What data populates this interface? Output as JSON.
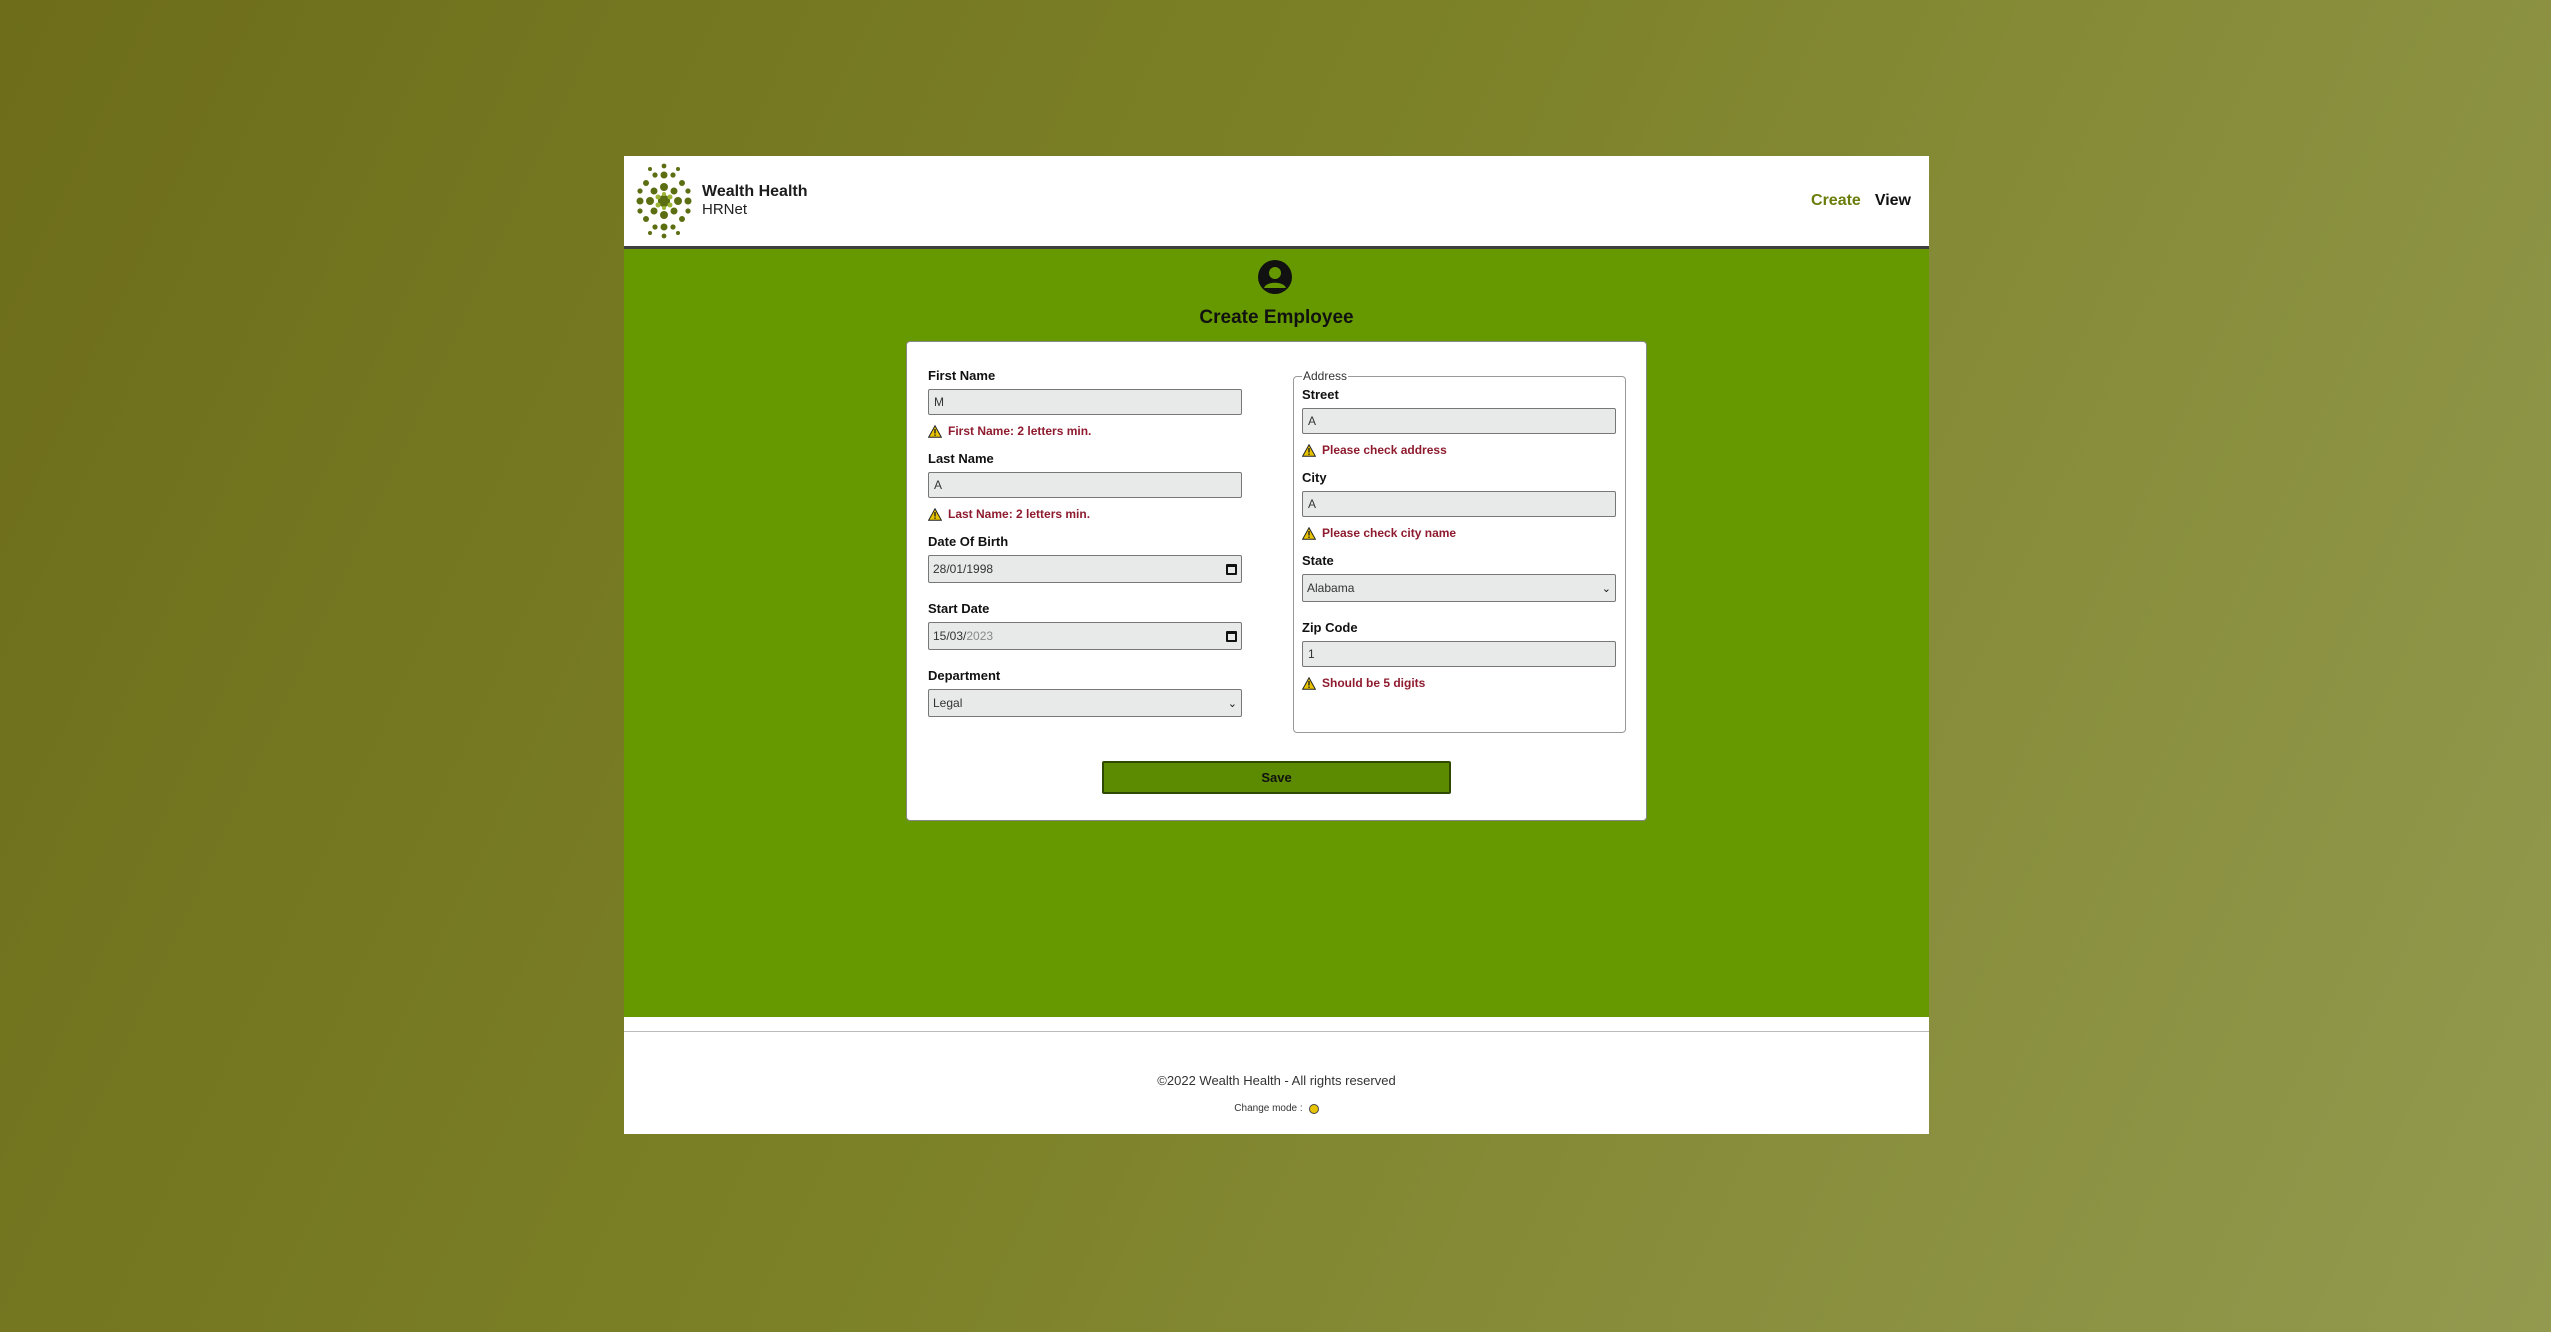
{
  "header": {
    "brand_name": "Wealth Health",
    "brand_sub": "HRNet",
    "nav": {
      "create": "Create",
      "view": "View"
    }
  },
  "page": {
    "title": "Create Employee"
  },
  "form": {
    "first_name": {
      "label": "First Name",
      "value": "M",
      "error": "First Name: 2 letters min."
    },
    "last_name": {
      "label": "Last Name",
      "value": "A",
      "error": "Last Name: 2 letters min."
    },
    "dob": {
      "label": "Date Of Birth",
      "value": "28/01/1998"
    },
    "start_date": {
      "label": "Start Date",
      "value_day_month": "15/03/",
      "value_year": "2023"
    },
    "department": {
      "label": "Department",
      "value": "Legal"
    },
    "address": {
      "legend": "Address",
      "street": {
        "label": "Street",
        "value": "A",
        "error": "Please check address"
      },
      "city": {
        "label": "City",
        "value": "A",
        "error": "Please check city name"
      },
      "state": {
        "label": "State",
        "value": "Alabama"
      },
      "zip": {
        "label": "Zip Code",
        "value": "1",
        "error": "Should be 5 digits"
      }
    },
    "save_label": "Save"
  },
  "footer": {
    "copyright": "©2022 Wealth Health - All rights reserved",
    "mode_label": "Change mode :"
  },
  "colors": {
    "main_bg": "#669900",
    "error_text": "#8e1b2e",
    "nav_active": "#6a7d0a",
    "save_bg": "#5c8a00"
  }
}
